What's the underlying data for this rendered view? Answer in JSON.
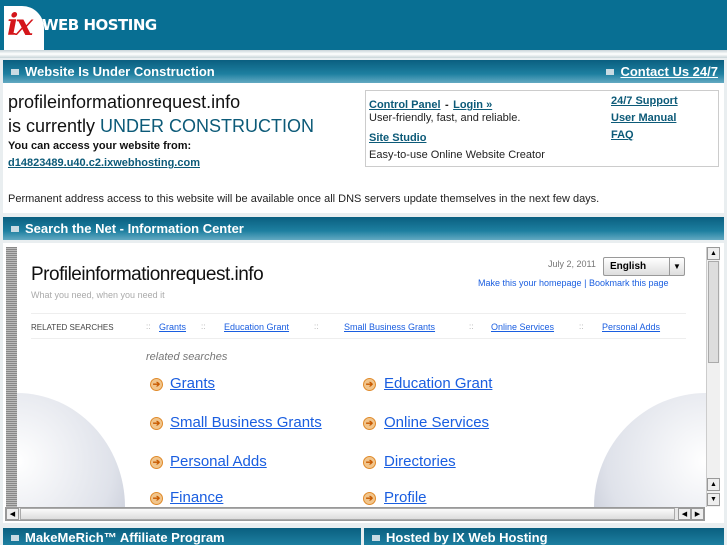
{
  "header": {
    "logo": "ix",
    "brand": "WEB HOSTING"
  },
  "construction": {
    "title": "Website Is Under Construction",
    "contact": "Contact Us 24/7",
    "domain": "profileinformationrequest.info",
    "currently": "is currently",
    "status": "UNDER CONSTRUCTION",
    "access_label": "You can access your website from:",
    "alt_url": "d14823489.u40.c2.ixwebhosting.com",
    "permanent": "Permanent address access to this website will be available once all DNS servers update themselves in the next few days."
  },
  "box": {
    "control_panel": "Control Panel",
    "dash": "-",
    "login": "Login »",
    "cp_desc": "User-friendly, fast, and reliable.",
    "site_studio": "Site Studio",
    "ss_desc": "Easy-to-use Online Website Creator",
    "support": "24/7 Support",
    "manual": "User Manual",
    "faq": "FAQ"
  },
  "search": {
    "title": "Search the Net - Information Center"
  },
  "frame": {
    "title": "Profileinformationrequest.info",
    "tagline": "What you need, when you need it",
    "date": "July 2, 2011",
    "language": "English",
    "homepage": "Make this your homepage",
    "bookmark": "Bookmark this page",
    "related_label": "RELATED SEARCHES",
    "sep": "::",
    "top_links": [
      "Grants",
      "Education Grant",
      "Small Business Grants",
      "Online Services",
      "Personal Adds"
    ],
    "related_heading": "related searches",
    "links": [
      "Grants",
      "Education Grant",
      "Small Business Grants",
      "Online Services",
      "Personal Adds",
      "Directories",
      "Finance",
      "Profile"
    ]
  },
  "footer": {
    "left": "MakeMeRich™ Affiliate Program",
    "right": "Hosted by IX Web Hosting"
  }
}
